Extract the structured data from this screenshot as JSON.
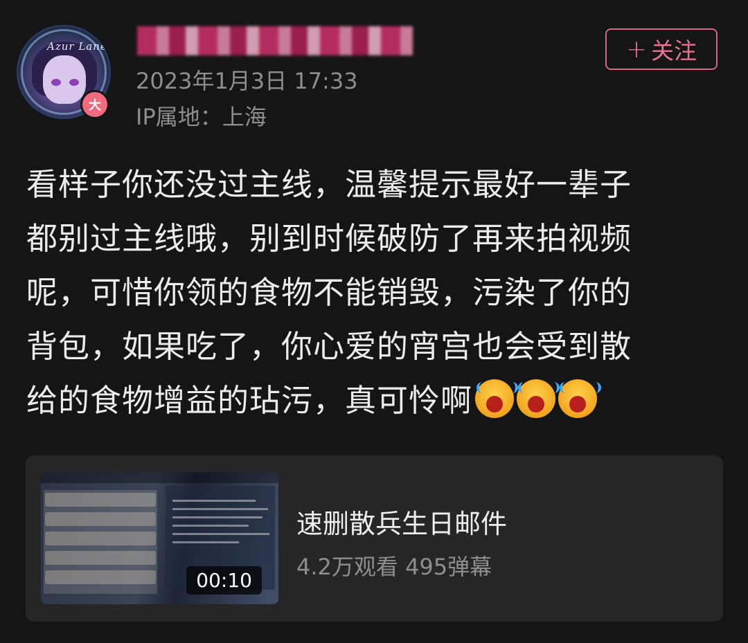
{
  "post": {
    "user_badge": "大",
    "avatar_text": "Azur Lane",
    "timestamp": "2023年1月3日 17:33",
    "ip_location": "IP属地：上海",
    "follow_label": "关注",
    "follow_icon": "+",
    "content_lines": [
      "看样子你还没过主线，温馨提示最好一辈子",
      "都别过主线哦，别到时候破防了再来拍视频",
      "呢，可惜你领的食物不能销毁，污染了你的",
      "背包，如果吃了，你心爱的宵宫也会受到散",
      "给的食物增益的玷污，真可怜啊"
    ],
    "emoji": [
      "crying-face",
      "crying-face",
      "crying-face"
    ]
  },
  "video_card": {
    "duration": "00:10",
    "title": "速删散兵生日邮件",
    "stats": "4.2万观看 495弹幕"
  }
}
